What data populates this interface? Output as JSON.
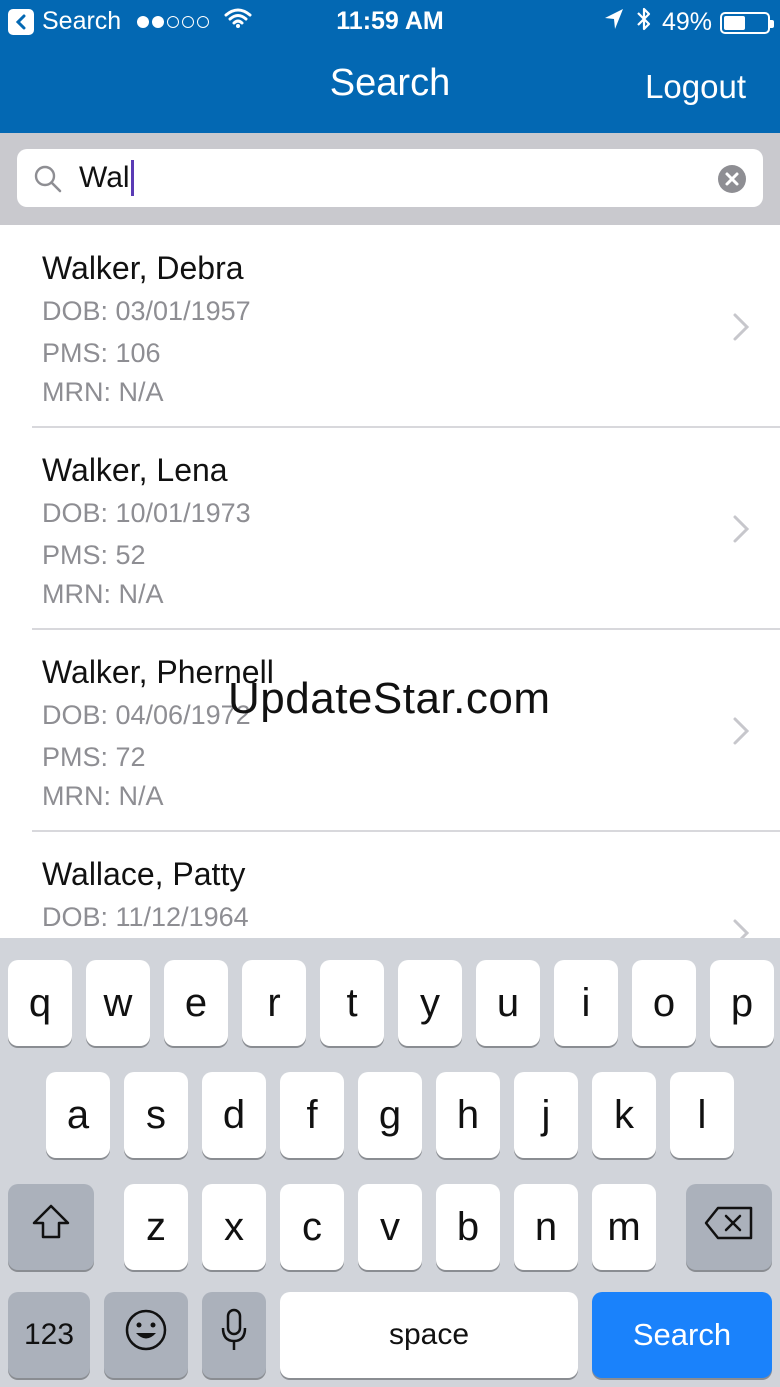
{
  "status_bar": {
    "back_label": "Search",
    "time": "11:59 AM",
    "battery": "49%",
    "battery_level": 0.49,
    "signal_bars_filled": 2,
    "signal_bars_total": 5
  },
  "nav": {
    "title": "Search",
    "logout_label": "Logout"
  },
  "search": {
    "value": "Wal"
  },
  "results": [
    {
      "name": "Walker, Debra",
      "dob": "DOB: 03/01/1957",
      "pms": "PMS: 106",
      "mrn": "MRN: N/A"
    },
    {
      "name": "Walker, Lena",
      "dob": "DOB: 10/01/1973",
      "pms": "PMS: 52",
      "mrn": "MRN: N/A"
    },
    {
      "name": "Walker, Phernell",
      "dob": "DOB: 04/06/1972",
      "pms": "PMS: 72",
      "mrn": "MRN: N/A"
    },
    {
      "name": "Wallace, Patty",
      "dob": "DOB: 11/12/1964",
      "pms": "",
      "mrn": ""
    }
  ],
  "watermark": "UpdateStar.com",
  "keyboard": {
    "row1": [
      "q",
      "w",
      "e",
      "r",
      "t",
      "y",
      "u",
      "i",
      "o",
      "p"
    ],
    "row2": [
      "a",
      "s",
      "d",
      "f",
      "g",
      "h",
      "j",
      "k",
      "l"
    ],
    "row3": [
      "z",
      "x",
      "c",
      "v",
      "b",
      "n",
      "m"
    ],
    "numbers_label": "123",
    "space_label": "space",
    "search_label": "Search"
  },
  "colors": {
    "nav_background": "#0368b3",
    "search_key": "#1a82fb",
    "caret": "#5a3bb5"
  },
  "icons": [
    "back-icon",
    "wifi-icon",
    "location-icon",
    "bluetooth-icon",
    "battery-icon",
    "search-icon",
    "clear-icon",
    "chevron-right-icon",
    "shift-icon",
    "backspace-icon",
    "emoji-icon",
    "microphone-icon"
  ]
}
